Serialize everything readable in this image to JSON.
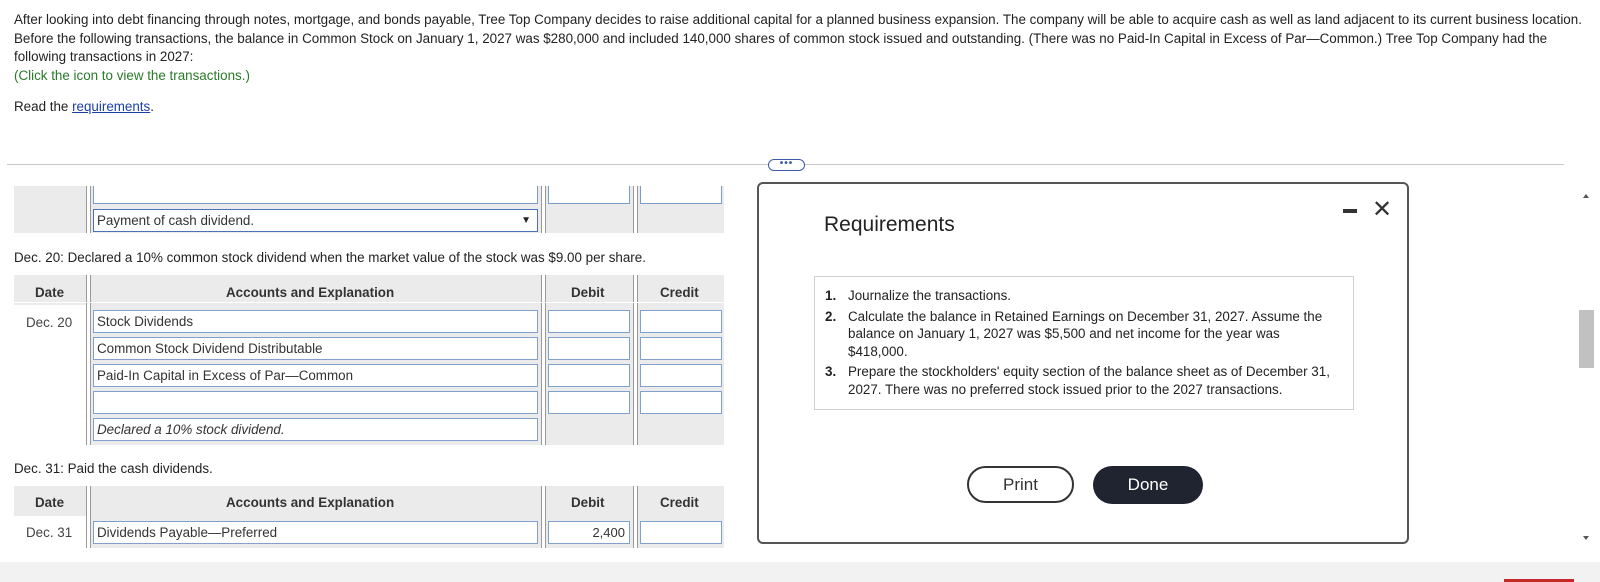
{
  "intro": {
    "paragraph": "After looking into debt financing through notes, mortgage, and bonds payable, Tree Top Company decides to raise additional capital for a planned business expansion. The company will be able to acquire cash as well as land adjacent to its current business location. Before the following transactions, the balance in Common Stock on January 1, 2027 was $280,000 and included 140,000 shares of common stock issued and outstanding. (There was no Paid-In Capital in Excess of Par—Common.) Tree Top Company had the following transactions in 2027:",
    "click_hint": "(Click the icon to view the transactions.)",
    "read_prefix": "Read the ",
    "read_link": "requirements",
    "read_suffix": "."
  },
  "more_button": "•••",
  "ledger": {
    "top_select_value": "Payment of cash dividend.",
    "dec20": {
      "description": "Dec. 20: Declared a 10% common stock dividend when the market value of the stock was $9.00 per share.",
      "headers": {
        "date": "Date",
        "accounts": "Accounts and Explanation",
        "debit": "Debit",
        "credit": "Credit"
      },
      "date": "Dec. 20",
      "rows": [
        "Stock Dividends",
        "Common Stock Dividend Distributable",
        "Paid-In Capital in Excess of Par—Common",
        ""
      ],
      "explanation": "Declared a 10% stock dividend."
    },
    "dec31": {
      "description": "Dec. 31: Paid the cash dividends.",
      "headers": {
        "date": "Date",
        "accounts": "Accounts and Explanation",
        "debit": "Debit",
        "credit": "Credit"
      },
      "date": "Dec. 31",
      "row_account": "Dividends Payable—Preferred",
      "row_debit": "2,400",
      "row_credit": ""
    }
  },
  "modal": {
    "title": "Requirements",
    "items": [
      {
        "num": "1.",
        "text": "Journalize the transactions."
      },
      {
        "num": "2.",
        "text": "Calculate the balance in Retained Earnings on December 31, 2027. Assume the balance on January 1, 2027 was $5,500 and net income for the year was $418,000."
      },
      {
        "num": "3.",
        "text": "Prepare the stockholders' equity section of the balance sheet as of December 31, 2027. There was no preferred stock issued prior to the 2027 transactions."
      }
    ],
    "print_label": "Print",
    "done_label": "Done",
    "close_glyph": "✕"
  }
}
